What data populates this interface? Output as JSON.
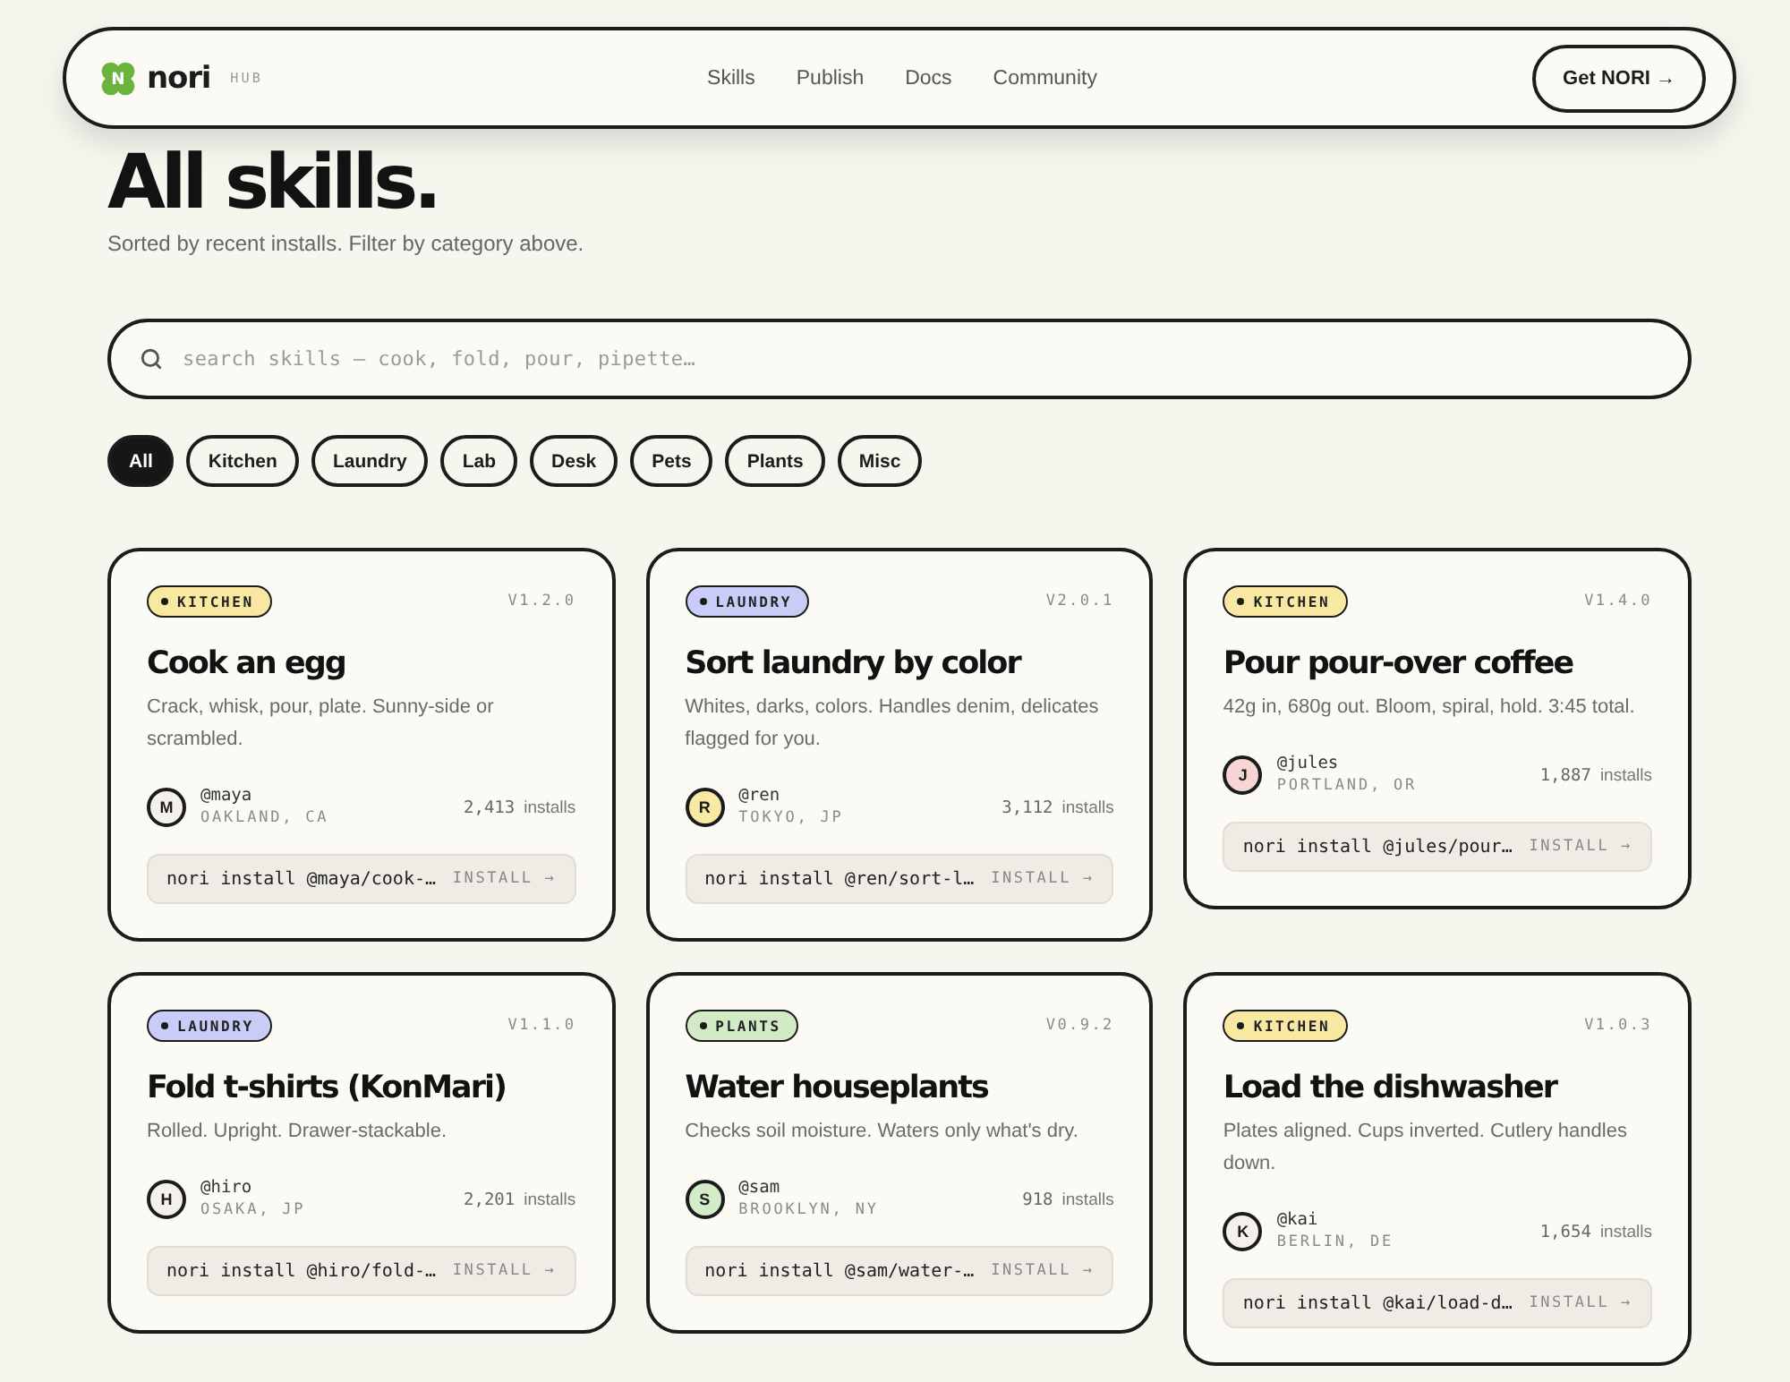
{
  "nav": {
    "brand": {
      "logo_letter": "N",
      "name": "nori",
      "tag": "HUB"
    },
    "links": [
      "Skills",
      "Publish",
      "Docs",
      "Community"
    ],
    "cta": "Get NORI →"
  },
  "header": {
    "title": "All skills.",
    "subtitle": "Sorted by recent installs. Filter by category above."
  },
  "search": {
    "placeholder": "search skills — cook, fold, pour, pipette…"
  },
  "filters": [
    {
      "label": "All",
      "selected": true
    },
    {
      "label": "Kitchen",
      "selected": false
    },
    {
      "label": "Laundry",
      "selected": false
    },
    {
      "label": "Lab",
      "selected": false
    },
    {
      "label": "Desk",
      "selected": false
    },
    {
      "label": "Pets",
      "selected": false
    },
    {
      "label": "Plants",
      "selected": false
    },
    {
      "label": "Misc",
      "selected": false
    }
  ],
  "cards": [
    {
      "category": {
        "label": "KITCHEN",
        "color": "#f8e8a2"
      },
      "version": "V1.2.0",
      "title": "Cook an egg",
      "description": "Crack, whisk, pour, plate. Sunny-side or scrambled.",
      "author": {
        "initial": "M",
        "color": "#f3f1e9",
        "handle": "@maya",
        "location": "OAKLAND, CA"
      },
      "installs": "2,413",
      "installs_label": "installs",
      "command": "nori install @maya/cook-…",
      "install_button": "INSTALL →"
    },
    {
      "category": {
        "label": "LAUNDRY",
        "color": "#c8ccf7"
      },
      "version": "V2.0.1",
      "title": "Sort laundry by color",
      "description": "Whites, darks, colors. Handles denim, delicates flagged for you.",
      "author": {
        "initial": "R",
        "color": "#f8e9a4",
        "handle": "@ren",
        "location": "TOKYO, JP"
      },
      "installs": "3,112",
      "installs_label": "installs",
      "command": "nori install @ren/sort-l…",
      "install_button": "INSTALL →"
    },
    {
      "category": {
        "label": "KITCHEN",
        "color": "#f8e8a2"
      },
      "version": "V1.4.0",
      "title": "Pour pour-over coffee",
      "description": "42g in, 680g out. Bloom, spiral, hold. 3:45 total.",
      "author": {
        "initial": "J",
        "color": "#f6d5d3",
        "handle": "@jules",
        "location": "PORTLAND, OR"
      },
      "installs": "1,887",
      "installs_label": "installs",
      "command": "nori install @jules/pour…",
      "install_button": "INSTALL →"
    },
    {
      "category": {
        "label": "LAUNDRY",
        "color": "#c8ccf7"
      },
      "version": "V1.1.0",
      "title": "Fold t-shirts (KonMari)",
      "description": "Rolled. Upright. Drawer-stackable.",
      "author": {
        "initial": "H",
        "color": "#f3f1e9",
        "handle": "@hiro",
        "location": "OSAKA, JP"
      },
      "installs": "2,201",
      "installs_label": "installs",
      "command": "nori install @hiro/fold-…",
      "install_button": "INSTALL →"
    },
    {
      "category": {
        "label": "PLANTS",
        "color": "#d2ebc6"
      },
      "version": "V0.9.2",
      "title": "Water houseplants",
      "description": "Checks soil moisture. Waters only what's dry.",
      "author": {
        "initial": "S",
        "color": "#d3ebc7",
        "handle": "@sam",
        "location": "BROOKLYN, NY"
      },
      "installs": "918",
      "installs_label": "installs",
      "command": "nori install @sam/water-…",
      "install_button": "INSTALL →"
    },
    {
      "category": {
        "label": "KITCHEN",
        "color": "#f8e8a2"
      },
      "version": "V1.0.3",
      "title": "Load the dishwasher",
      "description": "Plates aligned. Cups inverted. Cutlery handles down.",
      "author": {
        "initial": "K",
        "color": "#f3f1e9",
        "handle": "@kai",
        "location": "BERLIN, DE"
      },
      "installs": "1,654",
      "installs_label": "installs",
      "command": "nori install @kai/load-d…",
      "install_button": "INSTALL →"
    }
  ]
}
